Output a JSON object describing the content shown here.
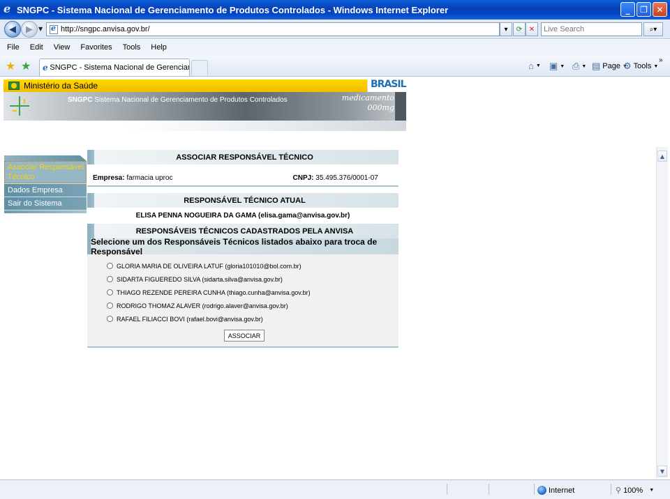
{
  "browser": {
    "window_title": "SNGPC - Sistema Nacional de Gerenciamento de Produtos Controlados - Windows Internet Explorer",
    "url": "http://sngpc.anvisa.gov.br/",
    "search_placeholder": "Live Search",
    "menu": [
      "File",
      "Edit",
      "View",
      "Favorites",
      "Tools",
      "Help"
    ],
    "tab_title": "SNGPC - Sistema Nacional de Gerenciamento de Produ...",
    "commands": {
      "page": "Page",
      "tools": "Tools"
    },
    "status": {
      "zone": "Internet",
      "zoom": "100%"
    }
  },
  "site": {
    "ministry": "Ministério da Saúde",
    "system_acronym": "SNGPC",
    "system_name": "Sistema Nacional de Gerenciamento de Produtos Controlados",
    "banner_word1": "medicamento",
    "banner_word2": "000mg",
    "brasil_logo": "BRASIL"
  },
  "sidebar": {
    "items": [
      {
        "label": "Associar Responsável Técnico",
        "active": true
      },
      {
        "label": "Dados Empresa",
        "active": false
      },
      {
        "label": "Sair do Sistema",
        "active": false
      }
    ]
  },
  "main": {
    "section_title": "ASSOCIAR RESPONSÁVEL TÉCNICO",
    "company_label": "Empresa:",
    "company_value": "farmacia uproc",
    "cnpj_label": "CNPJ:",
    "cnpj_value": "35.495.376/0001-07",
    "current_header": "RESPONSÁVEL TÉCNICO ATUAL",
    "current_rt": "ELISA PENNA NOGUEIRA DA GAMA (elisa.gama@anvisa.gov.br)",
    "registered_header": "RESPONSÁVEIS TÉCNICOS CADASTRADOS PELA ANVISA",
    "select_instruction": "Selecione um dos Responsáveis Técnicos listados abaixo para troca de Responsável",
    "options": [
      "GLORIA MARIA DE OLIVEIRA LATUF (gloria101010@bol.com.br)",
      "SIDARTA FIGUEREDO SILVA (sidarta.silva@anvisa.gov.br)",
      "THIAGO REZENDE PEREIRA CUNHA (thiago.cunha@anvisa.gov.br)",
      "RODRIGO THOMAZ ALAVER (rodrigo.alaver@anvisa.gov.br)",
      "RAFAEL FILIACCI BOVI (rafael.bovi@anvisa.gov.br)"
    ],
    "submit_label": "ASSOCIAR"
  },
  "colors": {
    "titlebar": "#0a3fb6",
    "banner_yellow": "#ffd800",
    "section_teal": "#96b7c5",
    "active_menu_text": "#ffd200"
  }
}
